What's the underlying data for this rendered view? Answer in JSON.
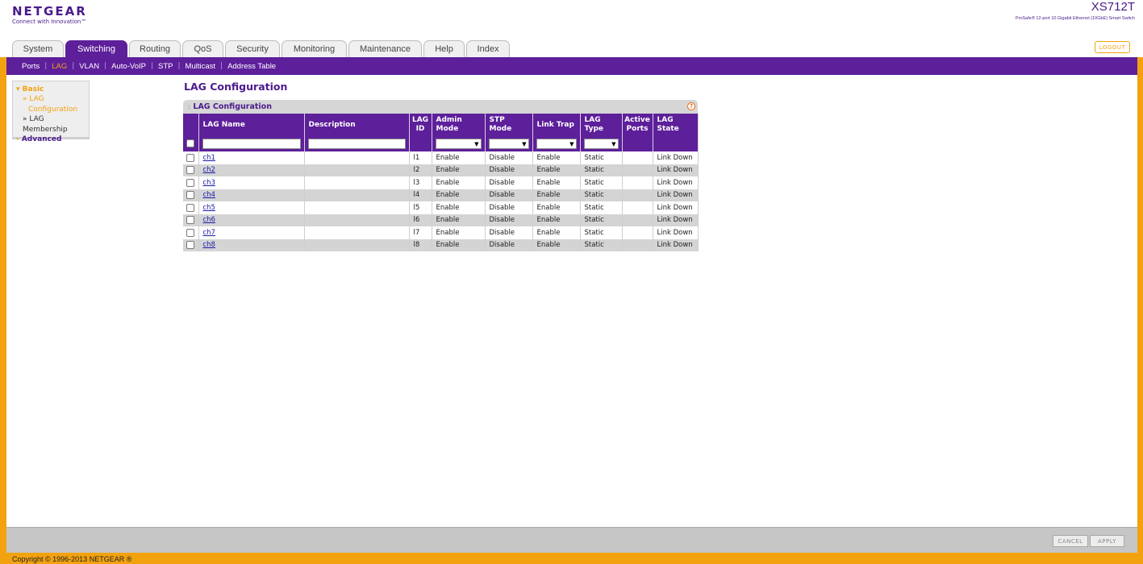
{
  "header": {
    "brand": "NETGEAR",
    "tagline": "Connect with Innovation™",
    "model": "XS712T",
    "model_desc": "ProSafe® 12-port 10 Gigabit Ethernet (10GbE) Smart Switch",
    "logout_label": "LOGOUT"
  },
  "tabs": [
    {
      "label": "System",
      "active": false
    },
    {
      "label": "Switching",
      "active": true
    },
    {
      "label": "Routing",
      "active": false
    },
    {
      "label": "QoS",
      "active": false
    },
    {
      "label": "Security",
      "active": false
    },
    {
      "label": "Monitoring",
      "active": false
    },
    {
      "label": "Maintenance",
      "active": false
    },
    {
      "label": "Help",
      "active": false
    },
    {
      "label": "Index",
      "active": false
    }
  ],
  "subnav": [
    {
      "label": "Ports",
      "active": false
    },
    {
      "label": "LAG",
      "active": true
    },
    {
      "label": "VLAN",
      "active": false
    },
    {
      "label": "Auto-VoIP",
      "active": false
    },
    {
      "label": "STP",
      "active": false
    },
    {
      "label": "Multicast",
      "active": false
    },
    {
      "label": "Address Table",
      "active": false
    }
  ],
  "leftmenu": {
    "basic_label": "Basic",
    "items": [
      {
        "label_1": "» LAG",
        "label_2": "Configuration",
        "active": true
      },
      {
        "label_1": "» LAG Membership",
        "label_2": "",
        "active": false
      }
    ],
    "advanced_label": "Advanced"
  },
  "page_title": "LAG Configuration",
  "panel": {
    "title": "LAG Configuration",
    "help_symbol": "?",
    "columns": [
      "LAG Name",
      "Description",
      "LAG ID",
      "Admin Mode",
      "STP Mode",
      "Link Trap",
      "LAG Type",
      "Active Ports",
      "LAG State"
    ],
    "rows": [
      {
        "name": "ch1",
        "description": "",
        "id": "l1",
        "admin": "Enable",
        "stp": "Disable",
        "trap": "Enable",
        "type": "Static",
        "active_ports": "",
        "state": "Link Down"
      },
      {
        "name": "ch2",
        "description": "",
        "id": "l2",
        "admin": "Enable",
        "stp": "Disable",
        "trap": "Enable",
        "type": "Static",
        "active_ports": "",
        "state": "Link Down"
      },
      {
        "name": "ch3",
        "description": "",
        "id": "l3",
        "admin": "Enable",
        "stp": "Disable",
        "trap": "Enable",
        "type": "Static",
        "active_ports": "",
        "state": "Link Down"
      },
      {
        "name": "ch4",
        "description": "",
        "id": "l4",
        "admin": "Enable",
        "stp": "Disable",
        "trap": "Enable",
        "type": "Static",
        "active_ports": "",
        "state": "Link Down"
      },
      {
        "name": "ch5",
        "description": "",
        "id": "l5",
        "admin": "Enable",
        "stp": "Disable",
        "trap": "Enable",
        "type": "Static",
        "active_ports": "",
        "state": "Link Down"
      },
      {
        "name": "ch6",
        "description": "",
        "id": "l6",
        "admin": "Enable",
        "stp": "Disable",
        "trap": "Enable",
        "type": "Static",
        "active_ports": "",
        "state": "Link Down"
      },
      {
        "name": "ch7",
        "description": "",
        "id": "l7",
        "admin": "Enable",
        "stp": "Disable",
        "trap": "Enable",
        "type": "Static",
        "active_ports": "",
        "state": "Link Down"
      },
      {
        "name": "ch8",
        "description": "",
        "id": "l8",
        "admin": "Enable",
        "stp": "Disable",
        "trap": "Enable",
        "type": "Static",
        "active_ports": "",
        "state": "Link Down"
      }
    ]
  },
  "buttons": {
    "cancel": "CANCEL",
    "apply": "APPLY"
  },
  "footer": {
    "copyright": "Copyright © 1996-2013 NETGEAR ®"
  },
  "colors": {
    "brand_purple": "#5d1f9a",
    "accent_orange": "#f2a20f"
  }
}
